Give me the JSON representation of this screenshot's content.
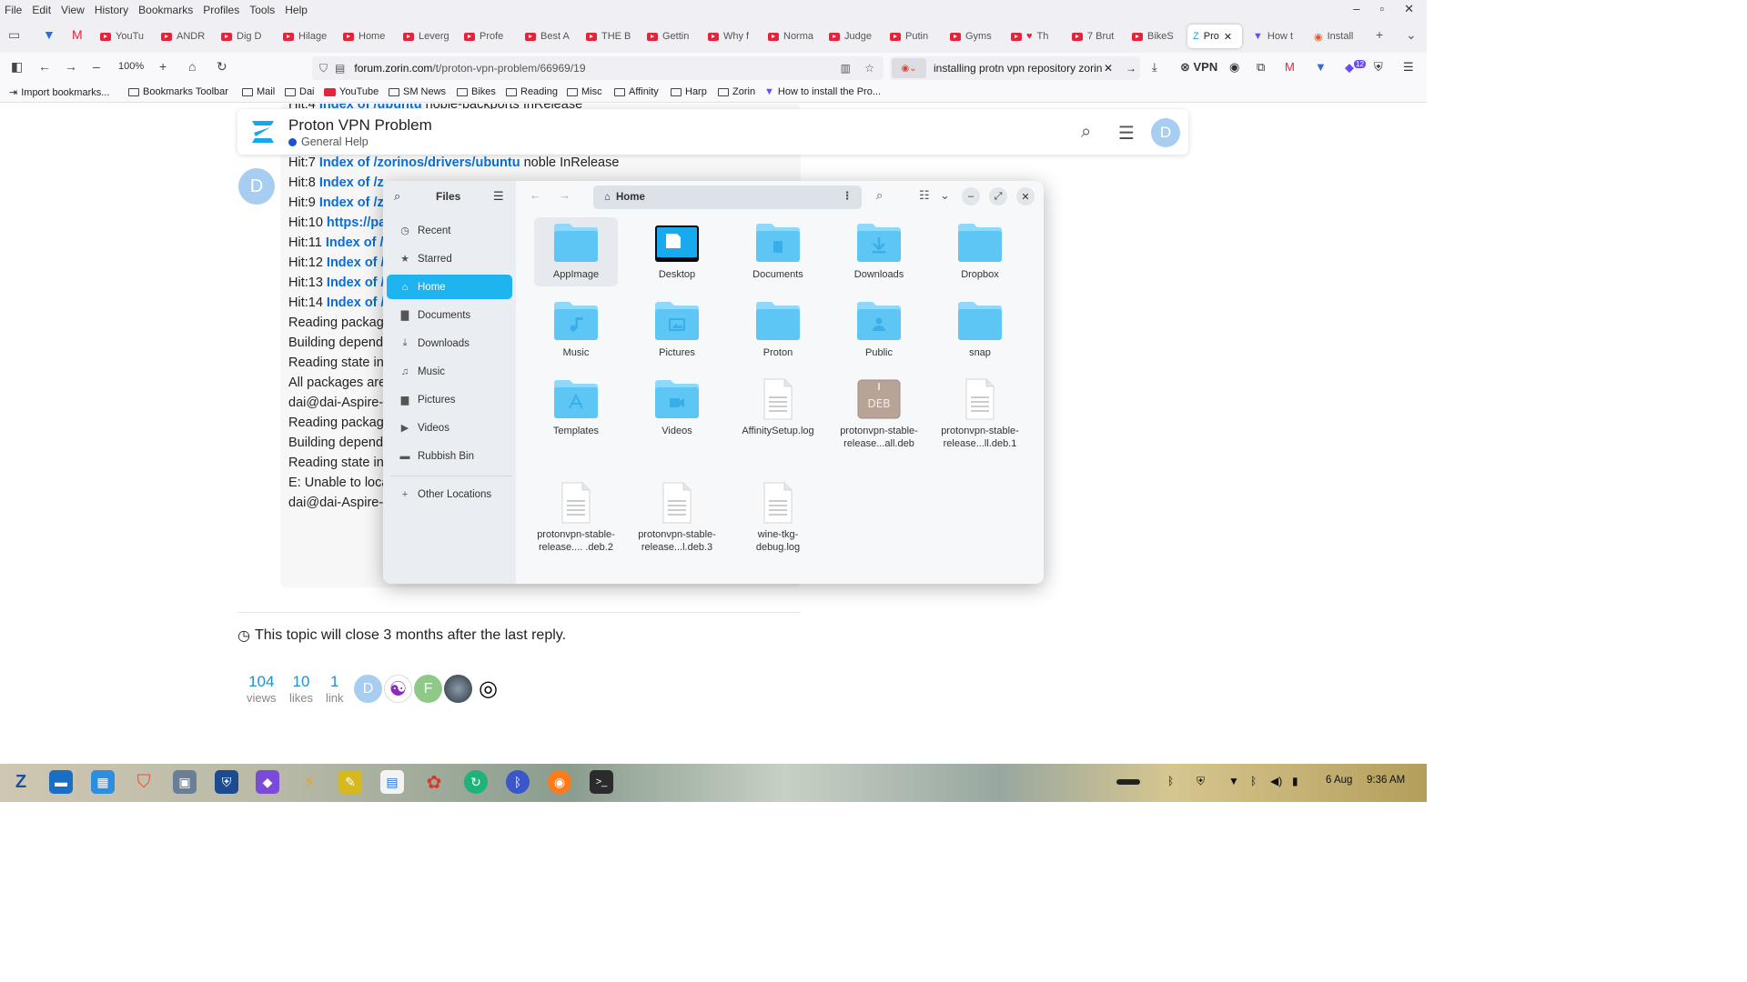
{
  "browser": {
    "menu": [
      "File",
      "Edit",
      "View",
      "History",
      "Bookmarks",
      "Profiles",
      "Tools",
      "Help"
    ],
    "tabs": [
      "YouTu",
      "ANDR",
      "Dig D",
      "Hilage",
      "Home",
      "Leverg",
      "Profe",
      "Best A",
      "THE B",
      "Gettin",
      "Why f",
      "Norma",
      "Judge",
      "Putin",
      "Gyms",
      "Th",
      "7 Brut",
      "BikeS",
      "Pro",
      "How t",
      "Install"
    ],
    "zoom": "100%",
    "url_host": "forum.zorin.com",
    "url_path": "/t/proton-vpn-problem/66969/19",
    "search_query": "installing protn vpn repository zorin",
    "vpn_label": "VPN",
    "badge_count": "12",
    "bookmarks": [
      "Import bookmarks...",
      "Bookmarks Toolbar",
      "Mail",
      "Dai",
      "YouTube",
      "SM News",
      "Bikes",
      "Reading",
      "Misc",
      "Affinity",
      "Harp",
      "Zorin",
      "How to install the Pro..."
    ]
  },
  "topic": {
    "title": "Proton VPN Problem",
    "category": "General Help",
    "user_initial": "D"
  },
  "post": {
    "lines": [
      {
        "pre": "Hit:4 ",
        "link": "Index of /ubuntu",
        "post": " noble-backports InRelease"
      },
      {
        "pre": "Hit:7 ",
        "link": "Index of /zorinos/drivers/ubuntu",
        "post": " noble InRelease"
      },
      {
        "pre": "Hit:8 ",
        "link": "Index of /z",
        "post": ""
      },
      {
        "pre": "Hit:9 ",
        "link": "Index of /z",
        "post": ""
      },
      {
        "pre": "Hit:10 ",
        "link": "https://pa",
        "post": ""
      },
      {
        "pre": "Hit:11 ",
        "link": "Index of /s",
        "post": ""
      },
      {
        "pre": "Hit:12 ",
        "link": "Index of /",
        "post": ""
      },
      {
        "pre": "Hit:13 ",
        "link": "Index of /",
        "post": ""
      },
      {
        "pre": "Hit:14 ",
        "link": "Index of /",
        "post": ""
      },
      {
        "pre": "Reading packag",
        "link": "",
        "post": ""
      },
      {
        "pre": "Building depend",
        "link": "",
        "post": ""
      },
      {
        "pre": "Reading state in",
        "link": "",
        "post": ""
      },
      {
        "pre": "All packages are",
        "link": "",
        "post": ""
      },
      {
        "pre": "dai@dai-Aspire-",
        "link": "",
        "post": ""
      },
      {
        "pre": "Reading packag",
        "link": "",
        "post": ""
      },
      {
        "pre": "Building depend",
        "link": "",
        "post": ""
      },
      {
        "pre": "Reading state in",
        "link": "",
        "post": ""
      },
      {
        "pre": "E: Unable to loca",
        "link": "",
        "post": ""
      },
      {
        "pre": "dai@dai-Aspire-",
        "link": "",
        "post": ""
      }
    ]
  },
  "footer": {
    "close_notice": "This topic will close 3 months after the last reply.",
    "views_n": "104",
    "views_l": "views",
    "likes_n": "10",
    "likes_l": "likes",
    "links_n": "1",
    "links_l": "link",
    "participant_d": "D",
    "participant_f": "F"
  },
  "files": {
    "app_title": "Files",
    "location": "Home",
    "sidebar": [
      "Recent",
      "Starred",
      "Home",
      "Documents",
      "Downloads",
      "Music",
      "Pictures",
      "Videos",
      "Rubbish Bin",
      "Other Locations"
    ],
    "items": [
      {
        "name": "AppImage",
        "kind": "folder"
      },
      {
        "name": "Desktop",
        "kind": "desktop"
      },
      {
        "name": "Documents",
        "kind": "folder-doc"
      },
      {
        "name": "Downloads",
        "kind": "folder-down"
      },
      {
        "name": "Dropbox",
        "kind": "folder"
      },
      {
        "name": "Music",
        "kind": "folder-music"
      },
      {
        "name": "Pictures",
        "kind": "folder-pic"
      },
      {
        "name": "Proton",
        "kind": "folder"
      },
      {
        "name": "Public",
        "kind": "folder-public"
      },
      {
        "name": "snap",
        "kind": "folder"
      },
      {
        "name": "Templates",
        "kind": "folder-tpl"
      },
      {
        "name": "Videos",
        "kind": "folder-video"
      },
      {
        "name": "AffinitySetup.log",
        "kind": "text"
      },
      {
        "name": "protonvpn-stable-release...all.deb",
        "kind": "deb"
      },
      {
        "name": "protonvpn-stable-release...ll.deb.1",
        "kind": "text"
      },
      {
        "name": "protonvpn-stable-release.... .deb.2",
        "kind": "text"
      },
      {
        "name": "protonvpn-stable-release...l.deb.3",
        "kind": "text"
      },
      {
        "name": "wine-tkg-debug.log",
        "kind": "text"
      }
    ],
    "deb_label": "DEB"
  },
  "taskbar": {
    "date": "6 Aug",
    "time": "9:36 AM"
  },
  "colors": {
    "link": "#0a6dd8",
    "folder": "#5ec6f5",
    "folder_dark": "#3aaee6",
    "selected": "#1eb4f0",
    "avatar": "#a7cdf0"
  }
}
